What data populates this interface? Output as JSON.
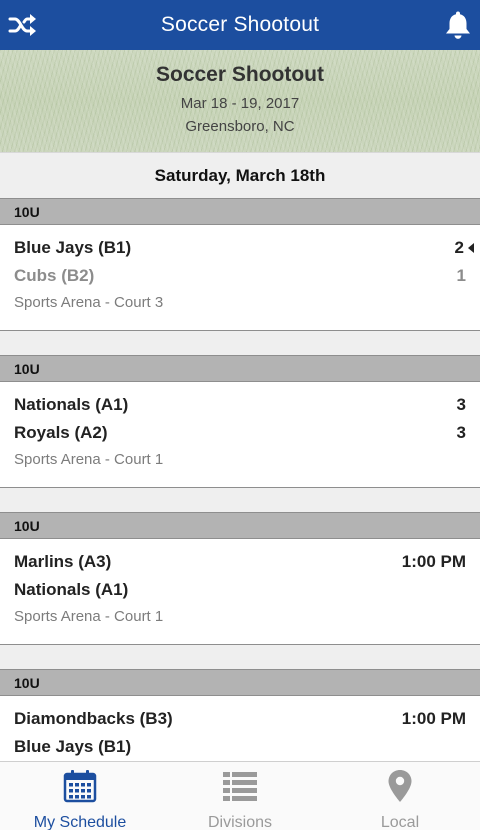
{
  "navbar": {
    "title": "Soccer Shootout",
    "left_icon": "shuffle-icon",
    "right_icon": "bell-icon"
  },
  "event": {
    "name": "Soccer Shootout",
    "dates": "Mar 18 - 19, 2017",
    "location": "Greensboro, NC"
  },
  "date_header": "Saturday, March 18th",
  "games": [
    {
      "division": "10U",
      "team1": "Blue Jays (B1)",
      "value1": "2",
      "team2": "Cubs (B2)",
      "value2": "1",
      "venue": "Sports Arena - Court 3",
      "winner": 1
    },
    {
      "division": "10U",
      "team1": "Nationals (A1)",
      "value1": "3",
      "team2": "Royals (A2)",
      "value2": "3",
      "venue": "Sports Arena - Court 1",
      "winner": 0
    },
    {
      "division": "10U",
      "team1": "Marlins (A3)",
      "value1": "1:00 PM",
      "team2": "Nationals (A1)",
      "value2": "",
      "venue": "Sports Arena - Court 1",
      "winner": 0
    },
    {
      "division": "10U",
      "team1": "Diamondbacks (B3)",
      "value1": "1:00 PM",
      "team2": "Blue Jays (B1)",
      "value2": "",
      "venue": "",
      "winner": 0
    }
  ],
  "tabs": [
    {
      "label": "My Schedule",
      "icon": "calendar-icon",
      "active": true
    },
    {
      "label": "Divisions",
      "icon": "list-icon",
      "active": false
    },
    {
      "label": "Local",
      "icon": "map-pin-icon",
      "active": false
    }
  ],
  "colors": {
    "brand": "#1c4e9f",
    "division_bar": "#b3b3b3",
    "muted_text": "#8c8c8c"
  }
}
